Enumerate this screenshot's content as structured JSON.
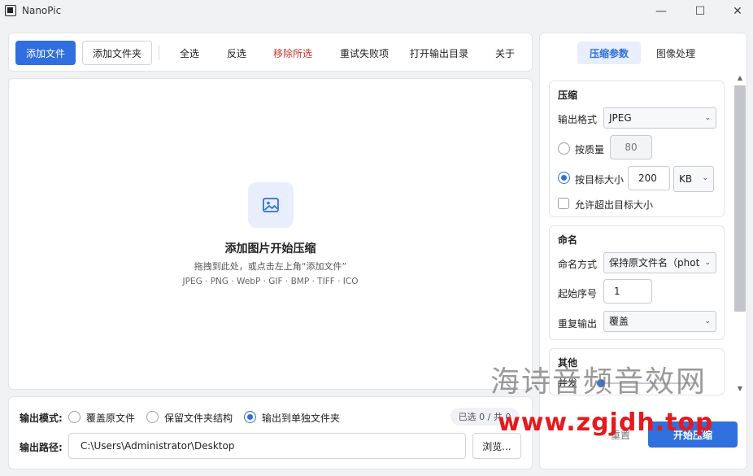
{
  "window": {
    "title": "NanoPic",
    "minimize": "—",
    "maximize": "☐",
    "close": "✕"
  },
  "toolbar": {
    "add_file": "添加文件",
    "add_folder": "添加文件夹",
    "select_all": "全选",
    "invert": "反选",
    "remove_selected": "移除所选",
    "retry_failed": "重试失败项",
    "open_output": "打开输出目录",
    "about": "关于"
  },
  "drop": {
    "title": "添加图片开始压缩",
    "hint": "拖拽到此处，或点击左上角“添加文件”",
    "formats": "JPEG · PNG · WebP · GIF · BMP · TIFF · ICO"
  },
  "output": {
    "mode_label": "输出模式:",
    "mode_options": [
      "覆盖原文件",
      "保留文件夹结构",
      "输出到单独文件夹"
    ],
    "selected_mode": "输出到单独文件夹",
    "count": "已选 0 / 共 0",
    "path_label": "输出路径:",
    "path_value": "C:\\Users\\Administrator\\Desktop",
    "browse": "浏览..."
  },
  "panel": {
    "tabs": [
      "压缩参数",
      "图像处理"
    ],
    "active_tab": "压缩参数",
    "compress": {
      "title": "压缩",
      "format_label": "输出格式",
      "format_value": "JPEG",
      "quality_label": "按质量",
      "quality_value": "80",
      "target_label": "按目标大小",
      "target_value": "200",
      "target_unit": "KB",
      "allow_exceed": "允许超出目标大小"
    },
    "naming": {
      "title": "命名",
      "mode_label": "命名方式",
      "mode_value": "保持原文件名（phot",
      "start_label": "起始序号",
      "start_value": "1",
      "dup_label": "重复输出",
      "dup_value": "覆盖"
    },
    "other": {
      "title": "其他",
      "row_label": "并发"
    },
    "reset": "重置",
    "start": "开始压缩"
  },
  "watermark": {
    "line1": "海诗音频音效网",
    "line2": "www.zgjdh.top"
  }
}
